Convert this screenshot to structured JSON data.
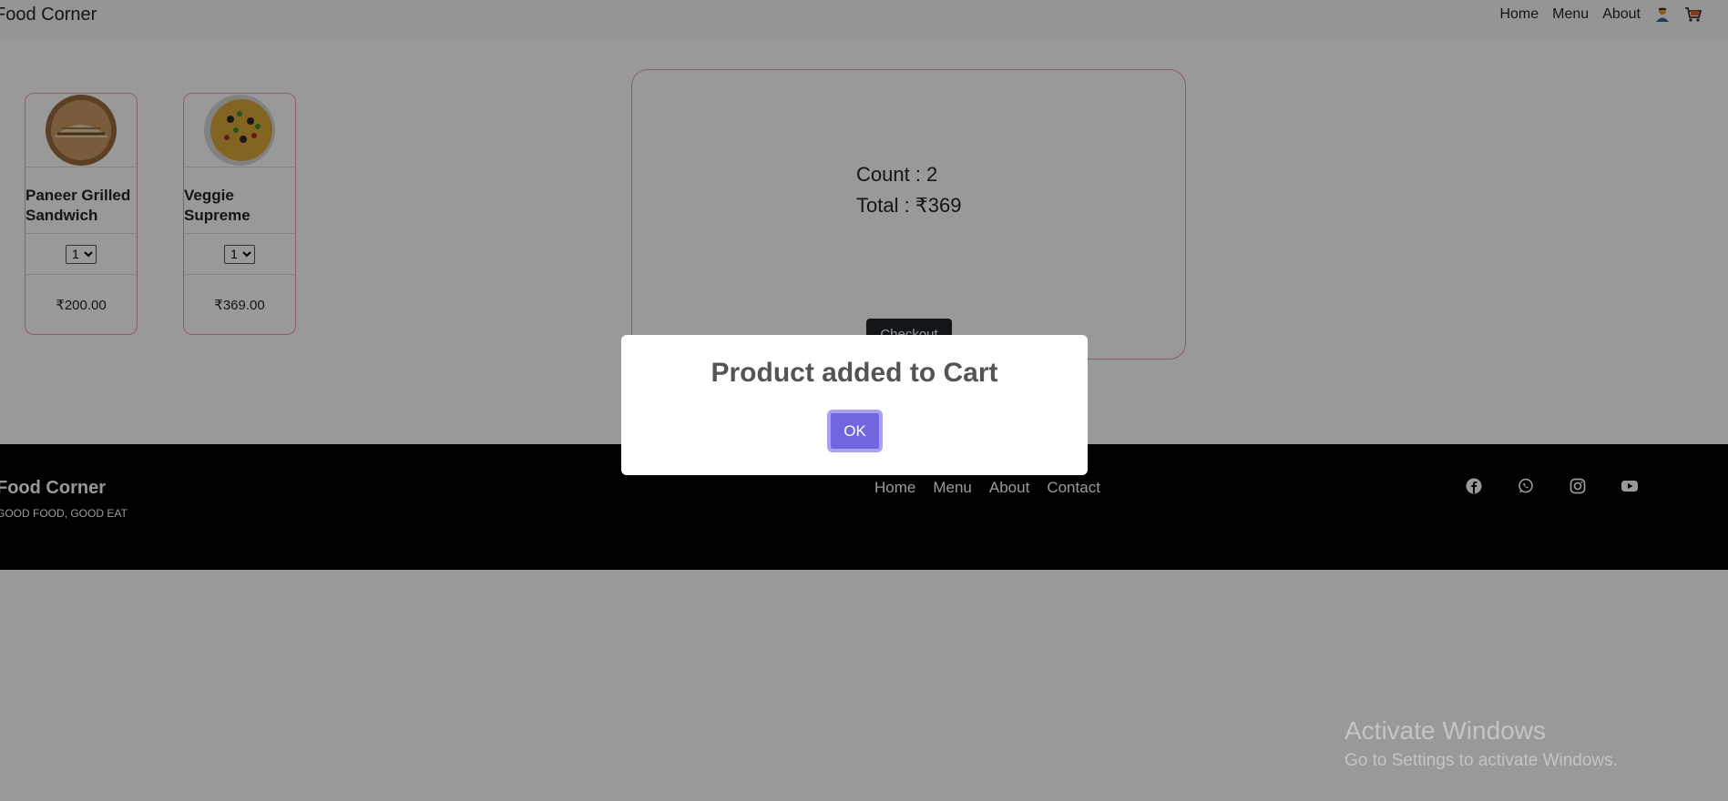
{
  "header": {
    "brand": "Food Corner",
    "nav": [
      "Home",
      "Menu",
      "About"
    ],
    "icons": [
      "user-icon",
      "cart-icon"
    ]
  },
  "products": [
    {
      "name": "Paneer Grilled Sandwich",
      "qty": "1",
      "price": "₹200.00",
      "image": "sandwich-image"
    },
    {
      "name": "Veggie Supreme",
      "qty": "1",
      "price": "₹369.00",
      "image": "pizza-image"
    }
  ],
  "cart": {
    "count_text": "Count : 2",
    "total_text": "Total : ₹369",
    "checkout_label": "Checkout"
  },
  "footer": {
    "brand": "Food Corner",
    "tagline": "GOOD FOOD, GOOD EAT",
    "links": [
      "Home",
      "Menu",
      "About",
      "Contact"
    ],
    "social_icons": [
      "facebook-icon",
      "whatsapp-icon",
      "instagram-icon",
      "youtube-icon"
    ]
  },
  "modal": {
    "title": "Product added to Cart",
    "ok_label": "OK",
    "accent": "#7066e0"
  },
  "watermark": {
    "line1": "Activate Windows",
    "line2": "Go to Settings to activate Windows."
  }
}
